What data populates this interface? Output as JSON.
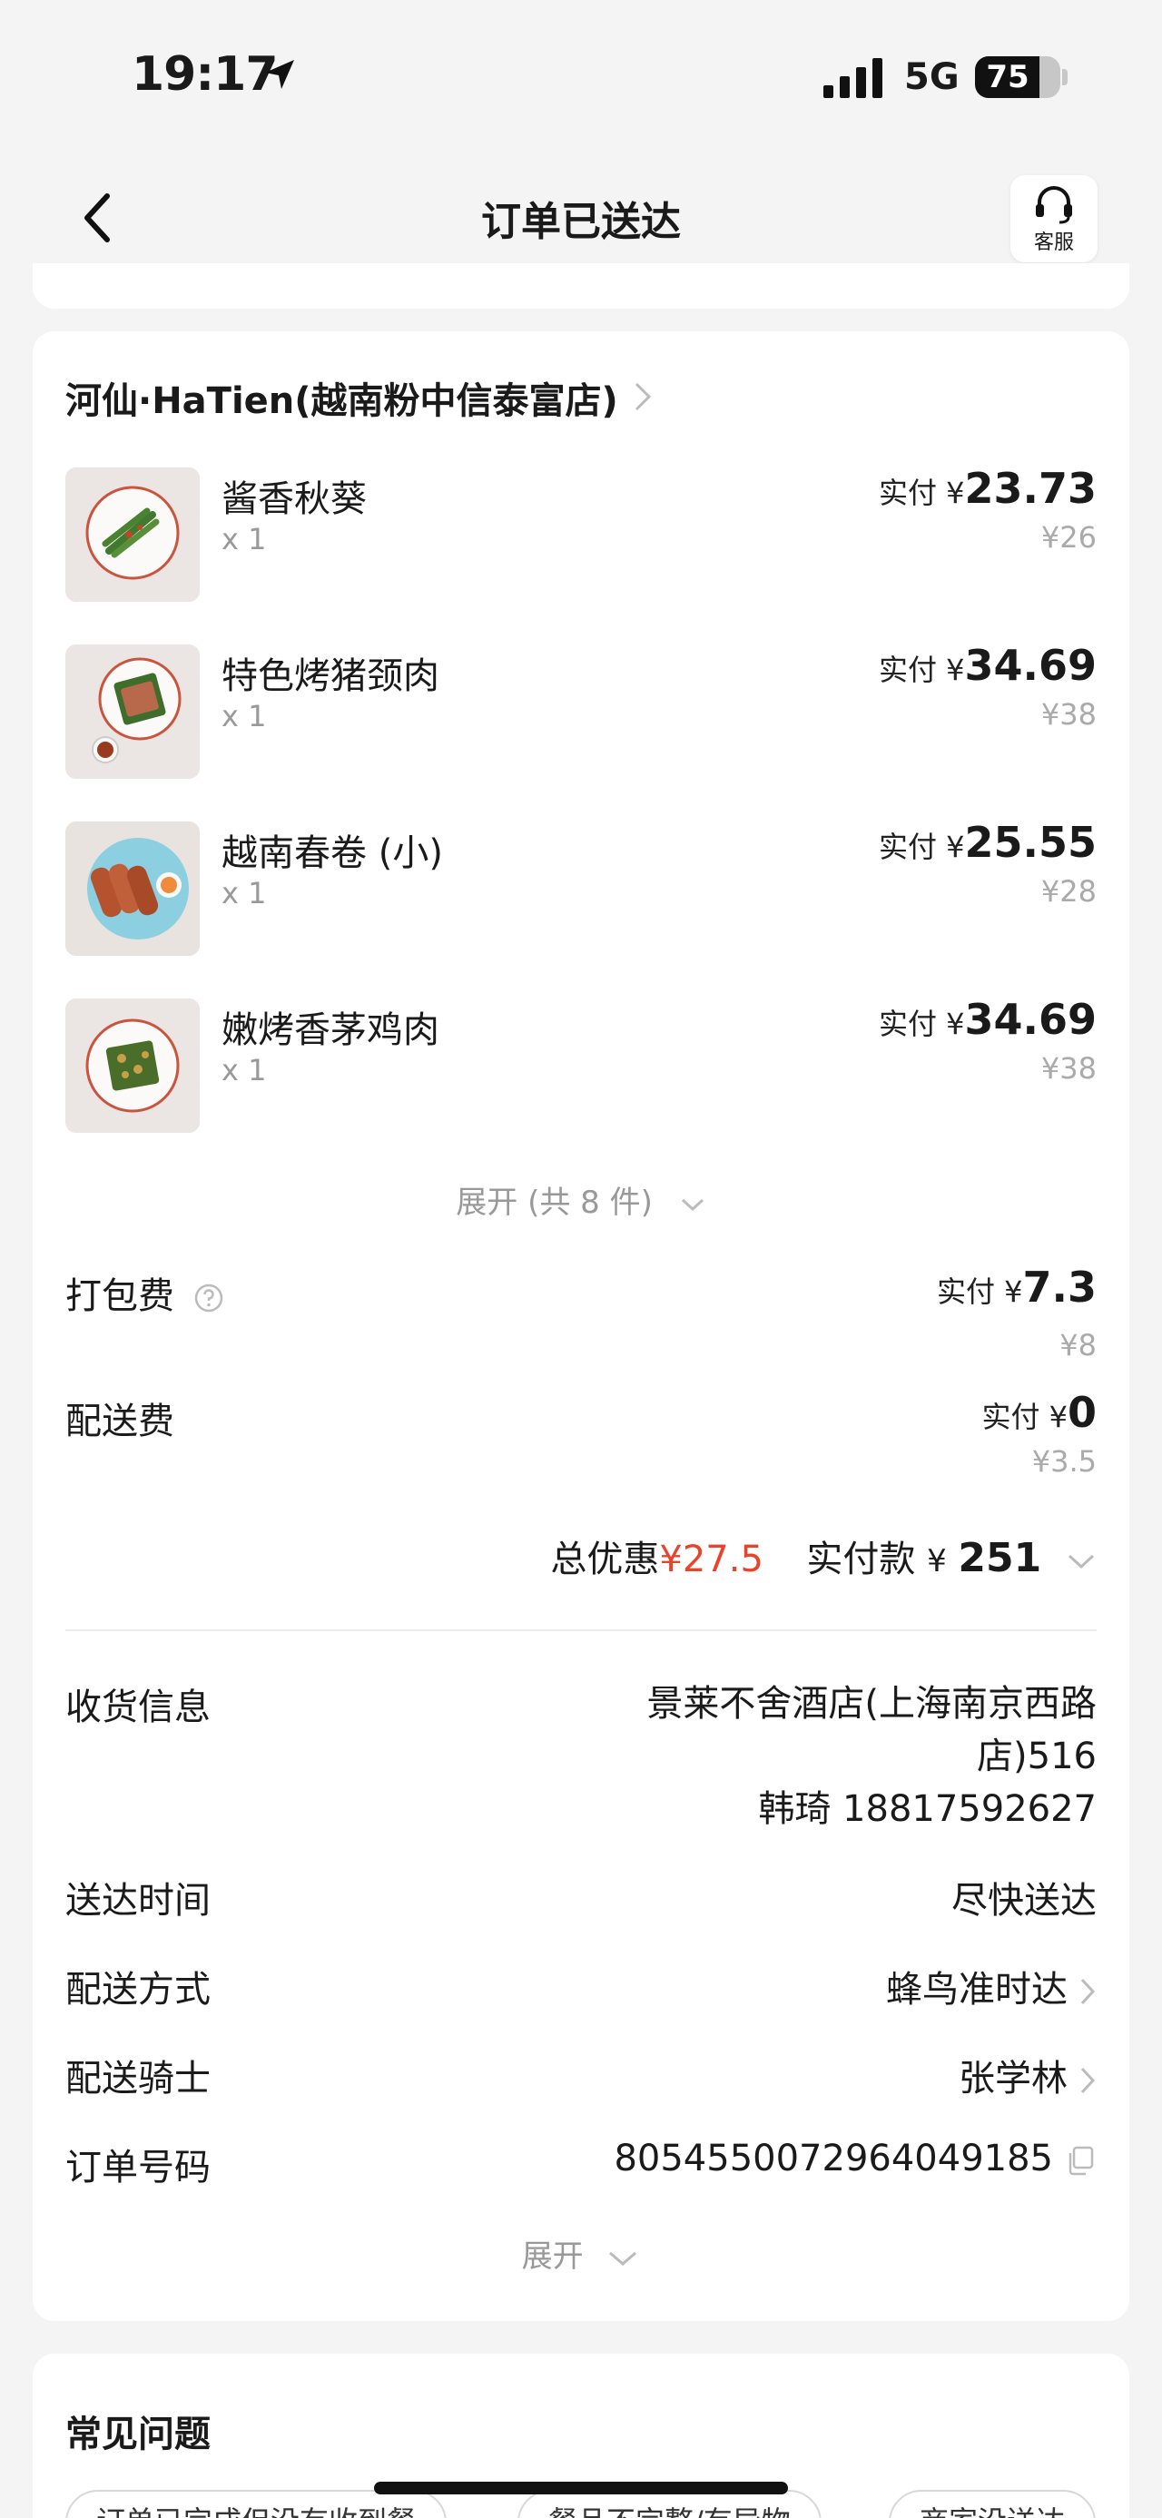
{
  "status_bar": {
    "time": "19:17",
    "network": "5G",
    "battery": 75
  },
  "header": {
    "title": "订单已送达",
    "support_label": "客服"
  },
  "shop": {
    "name": "河仙·HaTien(越南粉中信泰富店)"
  },
  "items": [
    {
      "name": "酱香秋葵",
      "qty": "x 1",
      "paid_prefix": "实付 ¥",
      "paid": "23.73",
      "original": "¥26",
      "image": "okra-dish-image"
    },
    {
      "name": "特色烤猪颈肉",
      "qty": "x 1",
      "paid_prefix": "实付 ¥",
      "paid": "34.69",
      "original": "¥38",
      "image": "grilled-pork-neck-image"
    },
    {
      "name": "越南春卷 (小)",
      "qty": "x 1",
      "paid_prefix": "实付 ¥",
      "paid": "25.55",
      "original": "¥28",
      "image": "spring-rolls-image"
    },
    {
      "name": "嫩烤香茅鸡肉",
      "qty": "x 1",
      "paid_prefix": "实付 ¥",
      "paid": "34.69",
      "original": "¥38",
      "image": "lemongrass-chicken-image"
    }
  ],
  "expand_items_label": "展开 (共 8 件)",
  "fees": {
    "packing": {
      "label": "打包费",
      "paid_prefix": "实付 ¥",
      "paid": "7.3",
      "original": "¥8"
    },
    "delivery": {
      "label": "配送费",
      "paid_prefix": "实付 ¥",
      "paid": "0",
      "original": "¥3.5"
    }
  },
  "summary": {
    "discount_label": "总优惠",
    "discount_value": "¥27.5",
    "total_label": "实付款",
    "total_currency": "¥",
    "total_value": "251"
  },
  "info": {
    "address_label": "收货信息",
    "address_line1": "景莱不舍酒店(上海南京西路店)516",
    "address_line2": "韩琦 18817592627",
    "time_label": "送达时间",
    "time_value": "尽快送达",
    "method_label": "配送方式",
    "method_value": "蜂鸟准时达",
    "rider_label": "配送骑士",
    "rider_value": "张学林",
    "order_no_label": "订单号码",
    "order_no_value": "8054550072964049185",
    "expand_label": "展开"
  },
  "faq": {
    "title": "常见问题",
    "chips": [
      "订单已完成但没有收到餐",
      "餐品不完整/有异物",
      "商家没送达"
    ]
  },
  "colors": {
    "accent_red": "#e8432b",
    "background": "#f4f4f4"
  }
}
